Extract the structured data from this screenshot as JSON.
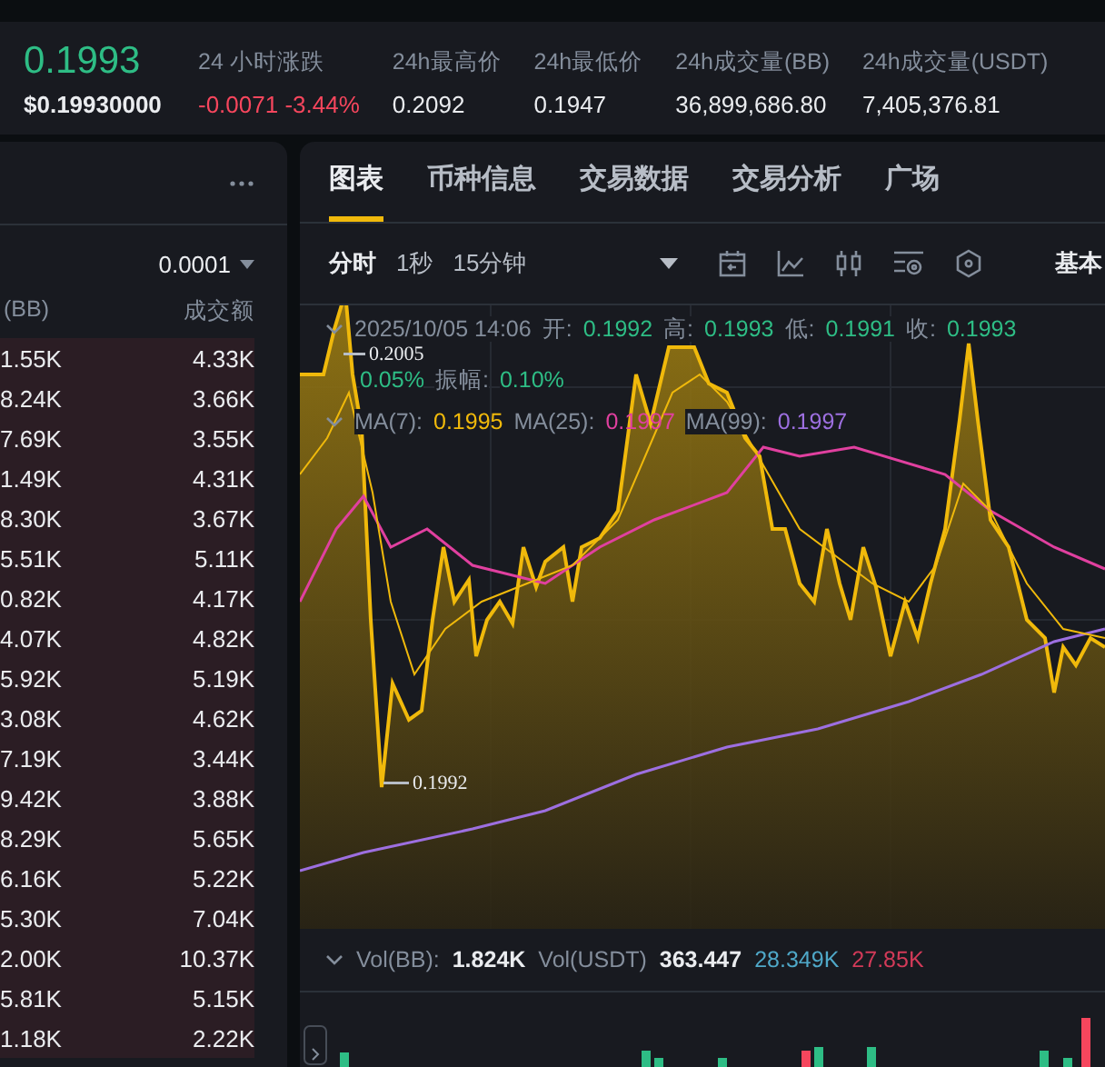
{
  "header": {
    "price": "0.1993",
    "price_usd": "$0.19930000",
    "stats": [
      {
        "label": "24 小时涨跌",
        "value": "-0.0071 -3.44%",
        "kind": "change"
      },
      {
        "label": "24h最高价",
        "value": "0.2092",
        "kind": "plain"
      },
      {
        "label": "24h最低价",
        "value": "0.1947",
        "kind": "plain"
      },
      {
        "label": "24h成交量(BB)",
        "value": "36,899,686.80",
        "kind": "plain"
      },
      {
        "label": "24h成交量(USDT)",
        "value": "7,405,376.81",
        "kind": "plain"
      }
    ]
  },
  "order_book": {
    "precision": "0.0001",
    "columns": [
      "(BB)",
      "成交额"
    ],
    "rows": [
      {
        "amount": "1.55K",
        "total": "4.33K"
      },
      {
        "amount": "8.24K",
        "total": "3.66K"
      },
      {
        "amount": "7.69K",
        "total": "3.55K"
      },
      {
        "amount": "1.49K",
        "total": "4.31K"
      },
      {
        "amount": "8.30K",
        "total": "3.67K"
      },
      {
        "amount": "5.51K",
        "total": "5.11K"
      },
      {
        "amount": "0.82K",
        "total": "4.17K"
      },
      {
        "amount": "4.07K",
        "total": "4.82K"
      },
      {
        "amount": "5.92K",
        "total": "5.19K"
      },
      {
        "amount": "3.08K",
        "total": "4.62K"
      },
      {
        "amount": "7.19K",
        "total": "3.44K"
      },
      {
        "amount": "9.42K",
        "total": "3.88K"
      },
      {
        "amount": "8.29K",
        "total": "5.65K"
      },
      {
        "amount": "6.16K",
        "total": "5.22K"
      },
      {
        "amount": "5.30K",
        "total": "7.04K"
      },
      {
        "amount": "2.00K",
        "total": "10.37K"
      },
      {
        "amount": "5.81K",
        "total": "5.15K"
      },
      {
        "amount": "1.18K",
        "total": "2.22K"
      }
    ]
  },
  "chart": {
    "tabs": [
      {
        "label": "图表",
        "selected": true
      },
      {
        "label": "币种信息",
        "selected": false
      },
      {
        "label": "交易数据",
        "selected": false
      },
      {
        "label": "交易分析",
        "selected": false
      },
      {
        "label": "广场",
        "selected": false
      }
    ],
    "intervals": [
      {
        "label": "分时",
        "selected": true
      },
      {
        "label": "1秒",
        "selected": false
      },
      {
        "label": "15分钟",
        "selected": false
      }
    ],
    "view_label": "基本",
    "candle": {
      "time": "2025/10/05 14:06",
      "fields": [
        {
          "label": "开:",
          "value": "0.1992"
        },
        {
          "label": "高:",
          "value": "0.1993"
        },
        {
          "label": "低:",
          "value": "0.1991"
        },
        {
          "label": "收:",
          "value": "0.1993"
        }
      ],
      "change": "0.05%",
      "amplitude_label": "振幅:",
      "amplitude": "0.10%"
    },
    "ma": [
      {
        "label": "MA(7):",
        "value": "0.1995",
        "color": "#f0b90b"
      },
      {
        "label": "MA(25):",
        "value": "0.1997",
        "color": "#e0409f"
      },
      {
        "label": "MA(99):",
        "value": "0.1997",
        "color": "#9d6fe0"
      }
    ],
    "high_label": "0.2005",
    "low_label": "0.1992",
    "volume": {
      "items": [
        {
          "label": "Vol(BB):",
          "value": "1.824K"
        },
        {
          "label": "Vol(USDT)",
          "value": "363.447"
        }
      ],
      "extras": [
        {
          "value": "28.349K",
          "color": "#4fa8c8"
        },
        {
          "value": "27.85K",
          "color": "#d23a58"
        }
      ]
    }
  }
}
